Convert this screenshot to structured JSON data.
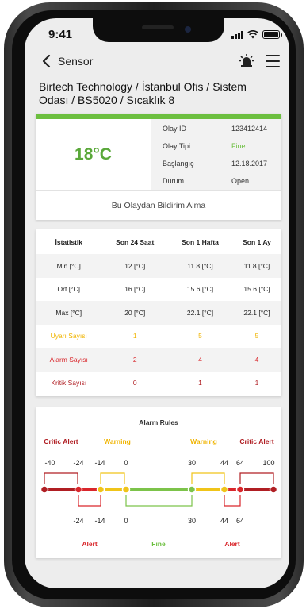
{
  "status": {
    "time": "9:41"
  },
  "nav": {
    "title": "Sensor"
  },
  "breadcrumb": "Birtech Technology / İstanbul Ofis / Sistem Odası / BS5020 / Sıcaklık 8",
  "event": {
    "temperature": "18°C",
    "rows": [
      {
        "label": "Olay ID",
        "value": "123412414"
      },
      {
        "label": "Olay Tipi",
        "value": "Fine"
      },
      {
        "label": "Başlangıç",
        "value": "12.18.2017"
      },
      {
        "label": "Durum",
        "value": "Open"
      }
    ],
    "notify_label": "Bu Olaydan Bildirim Alma"
  },
  "stats": {
    "headers": [
      "İstatistik",
      "Son 24 Saat",
      "Son 1 Hafta",
      "Son 1 Ay"
    ],
    "rows": [
      {
        "label": "Min  [°C]",
        "values": [
          "12  [°C]",
          "11.8  [°C]",
          "11.8  [°C]"
        ]
      },
      {
        "label": "Ort [°C]",
        "values": [
          "16 [°C]",
          "15.6 [°C]",
          "15.6 [°C]"
        ]
      },
      {
        "label": "Max [°C]",
        "values": [
          "20 [°C]",
          "22.1 [°C]",
          "22.1 [°C]"
        ]
      },
      {
        "label": "Uyarı Sayısı",
        "values": [
          "1",
          "5",
          "5"
        ]
      },
      {
        "label": "Alarm Sayısı",
        "values": [
          "2",
          "4",
          "4"
        ]
      },
      {
        "label": "Kritik Sayısı",
        "values": [
          "0",
          "1",
          "1"
        ]
      }
    ]
  },
  "rules": {
    "title": "Alarm Rules",
    "top_labels": {
      "critic_left": "Critic Alert",
      "warning_left": "Warning",
      "warning_right": "Warning",
      "critic_right": "Critic Alert"
    },
    "top_values": [
      "-40",
      "-24",
      "-14",
      "0",
      "30",
      "44",
      "64",
      "100"
    ],
    "bottom_values": [
      "-24",
      "-14",
      "0",
      "30",
      "44",
      "64"
    ],
    "bottom_labels": {
      "alert_left": "Alert",
      "fine": "Fine",
      "alert_right": "Alert"
    },
    "colors": {
      "critic": "#b01e23",
      "alert": "#d9262b",
      "warning": "#f0c419",
      "fine": "#7cc34a"
    }
  },
  "colors": {
    "accent": "#6cbf3f"
  }
}
